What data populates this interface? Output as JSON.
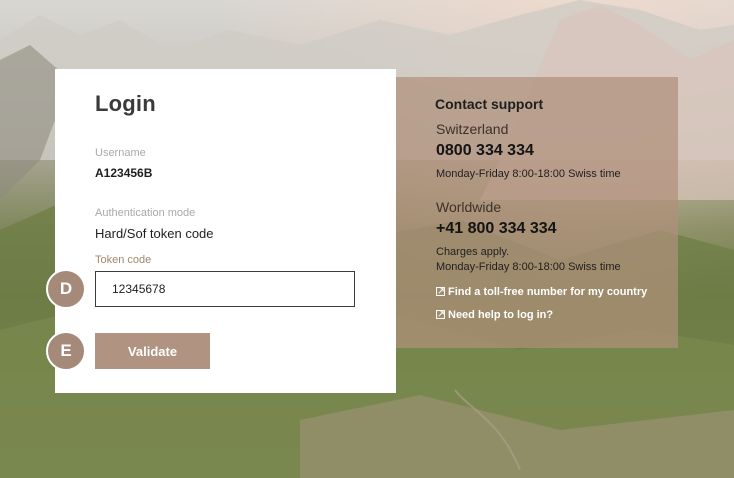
{
  "login": {
    "title": "Login",
    "username_label": "Username",
    "username_value": "A123456B",
    "auth_mode_label": "Authentication mode",
    "auth_mode_value": "Hard/Sof token code",
    "token_label": "Token code",
    "token_value": "12345678",
    "validate_label": "Validate"
  },
  "markers": {
    "d": "D",
    "e": "E"
  },
  "support": {
    "title": "Contact support",
    "switzerland": {
      "region": "Switzerland",
      "phone": "0800 334 334",
      "hours": "Monday-Friday 8:00-18:00 Swiss time"
    },
    "worldwide": {
      "region": "Worldwide",
      "phone": "+41 800 334 334",
      "charges": "Charges apply.",
      "hours": "Monday-Friday 8:00-18:00 Swiss time"
    },
    "links": {
      "tollfree": "Find a toll-free number for my country",
      "help": "Need help to log in?"
    }
  },
  "colors": {
    "accent": "#b09381",
    "marker": "#a58a79",
    "panel": "#b0907c"
  },
  "icons": {
    "link": "external-link-icon"
  }
}
